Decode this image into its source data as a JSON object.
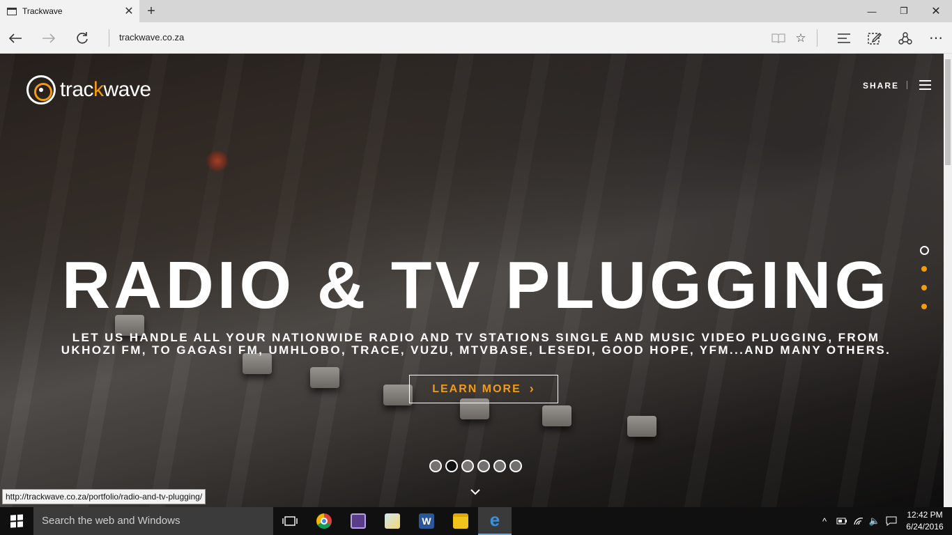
{
  "browser": {
    "tab_title": "Trackwave",
    "url": "trackwave.co.za",
    "status_url": "http://trackwave.co.za/portfolio/radio-and-tv-plugging/"
  },
  "site": {
    "logo_part1": "trac",
    "logo_part2": "k",
    "logo_part3": "wave",
    "share_label": "SHARE",
    "hero_title": "RADIO & TV PLUGGING",
    "hero_subtitle_line1": "LET US HANDLE ALL YOUR NATIONWIDE RADIO AND TV STATIONS SINGLE AND MUSIC VIDEO PLUGGING, FROM",
    "hero_subtitle_line2": "UKHOZI FM, TO GAGASI FM, UMHLOBO, TRACE, VUZU, MTVBASE, LESEDI, GOOD HOPE, YFM...AND MANY OTHERS.",
    "cta_label": "LEARN MORE",
    "slide_count": 6,
    "active_slide": 2,
    "side_nav_count": 4,
    "active_side_nav": 1,
    "accent_color": "#f39c12"
  },
  "taskbar": {
    "search_placeholder": "Search the web and Windows",
    "time": "12:42 PM",
    "date": "6/24/2016"
  }
}
